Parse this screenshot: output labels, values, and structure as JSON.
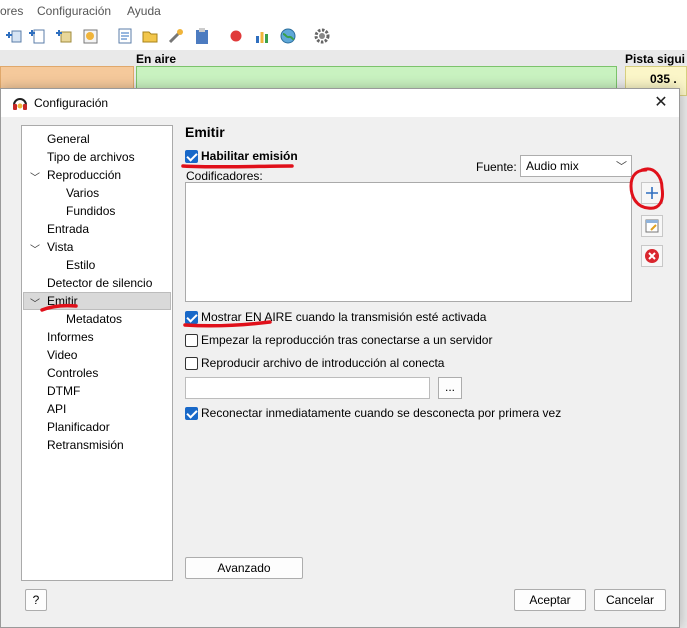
{
  "menu": {
    "items": [
      "ores",
      "Configuración",
      "Ayuda"
    ]
  },
  "main": {
    "on_air_label": "En aire",
    "next_track_label": "Pista sigui",
    "next_track_number": "035 ."
  },
  "dialog": {
    "title": "Configuración",
    "close_glyph": "✕",
    "tree": [
      {
        "label": "General",
        "level": 0
      },
      {
        "label": "Tipo de archivos",
        "level": 0
      },
      {
        "label": "Reproducción",
        "level": 0,
        "expanded": true
      },
      {
        "label": "Varios",
        "level": 1
      },
      {
        "label": "Fundidos",
        "level": 1
      },
      {
        "label": "Entrada",
        "level": 0
      },
      {
        "label": "Vista",
        "level": 0,
        "expanded": true
      },
      {
        "label": "Estilo",
        "level": 1
      },
      {
        "label": "Detector de silencio",
        "level": 0
      },
      {
        "label": "Emitir",
        "level": 0,
        "expanded": true,
        "selected": true
      },
      {
        "label": "Metadatos",
        "level": 1
      },
      {
        "label": "Informes",
        "level": 0
      },
      {
        "label": "Video",
        "level": 0
      },
      {
        "label": "Controles",
        "level": 0
      },
      {
        "label": "DTMF",
        "level": 0
      },
      {
        "label": "API",
        "level": 0
      },
      {
        "label": "Planificador",
        "level": 0
      },
      {
        "label": "Retransmisión",
        "level": 0
      }
    ],
    "panel": {
      "title": "Emitir",
      "enable_broadcast": {
        "label": "Habilitar emisión",
        "checked": true
      },
      "source_label": "Fuente:",
      "source_value": "Audio mix",
      "encoders_label": "Codificadores:",
      "show_on_air": {
        "label": "Mostrar EN AIRE cuando la transmisión esté activada",
        "checked": true
      },
      "start_playback": {
        "label": "Empezar la reproducción tras conectarse a un servidor",
        "checked": false
      },
      "play_intro": {
        "label": "Reproducir archivo de introducción al conecta",
        "checked": false
      },
      "intro_path_value": "",
      "browse_label": "...",
      "reconnect": {
        "label": "Reconectar inmediatamente cuando se desconecta por primera vez",
        "checked": true
      },
      "advanced_label": "Avanzado"
    },
    "help_label": "?",
    "accept_label": "Aceptar",
    "cancel_label": "Cancelar"
  },
  "colors": {
    "checkbox_accent": "#1868c8",
    "on_air_green": "#c9f2c0",
    "annotation_red": "#e0101a",
    "remove_icon_red": "#d9262e"
  }
}
